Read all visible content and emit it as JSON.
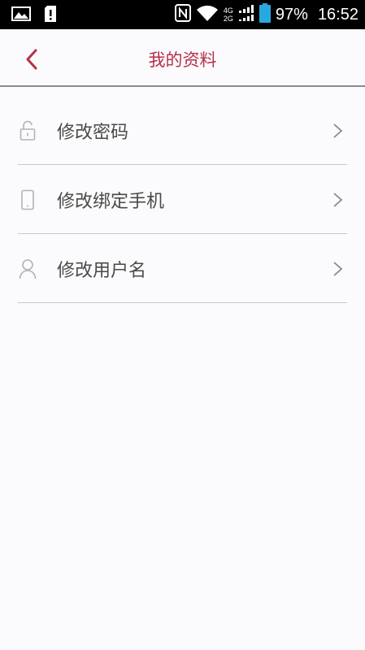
{
  "status_bar": {
    "battery": "97%",
    "time": "16:52",
    "net_top": "4G",
    "net_bottom": "2G"
  },
  "header": {
    "title": "我的资料"
  },
  "menu": {
    "items": [
      {
        "label": "修改密码",
        "icon": "unlock-icon"
      },
      {
        "label": "修改绑定手机",
        "icon": "phone-icon"
      },
      {
        "label": "修改用户名",
        "icon": "user-icon"
      }
    ]
  },
  "colors": {
    "accent": "#b5304a",
    "background": "#fbfafc",
    "text": "#4a4a4a",
    "divider": "#c9c9cc"
  }
}
